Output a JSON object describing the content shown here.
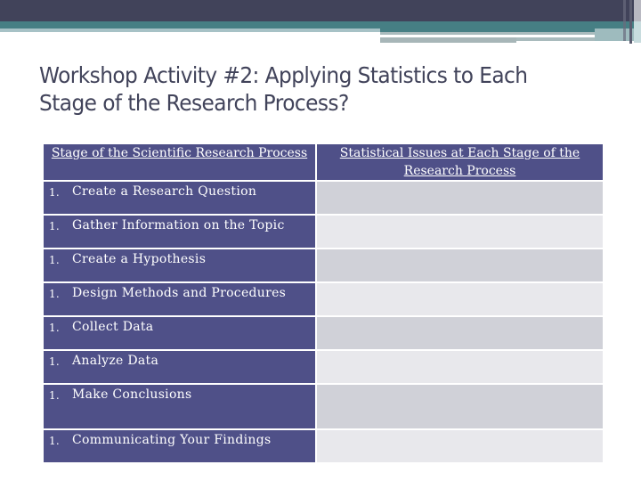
{
  "slide": {
    "title": "Workshop Activity #2: Applying Statistics to Each Stage of the Research Process?",
    "colors": {
      "header_band": "#41435a",
      "accent_teal": "#467f84",
      "stage_cell": "#4f5088",
      "issue_cell_odd": "#d0d1d8",
      "issue_cell_even": "#e8e8ec",
      "title_text": "#41435a"
    }
  },
  "table": {
    "headers": [
      "Stage of the Scientific Research Process",
      "Statistical Issues at Each Stage of the Research Process"
    ],
    "rows": [
      {
        "number": "1.",
        "stage": "Create a Research Question",
        "issue": ""
      },
      {
        "number": "1.",
        "stage": "Gather Information on the Topic",
        "issue": ""
      },
      {
        "number": "1.",
        "stage": "Create a Hypothesis",
        "issue": ""
      },
      {
        "number": "1.",
        "stage": "Design Methods and Procedures",
        "issue": ""
      },
      {
        "number": "1.",
        "stage": "Collect Data",
        "issue": ""
      },
      {
        "number": "1.",
        "stage": "Analyze Data",
        "issue": ""
      },
      {
        "number": "1.",
        "stage": "Make Conclusions",
        "issue": ""
      },
      {
        "number": "1.",
        "stage": "Communicating Your Findings",
        "issue": ""
      }
    ]
  }
}
